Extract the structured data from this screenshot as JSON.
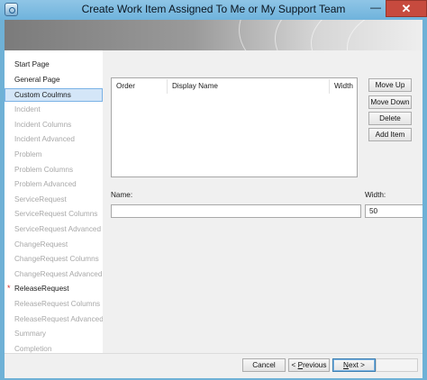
{
  "window": {
    "title": "Create Work Item Assigned To Me or My Support Team",
    "minimize_glyph": "—",
    "close_glyph": "✕"
  },
  "nav": {
    "items": [
      {
        "label": "Start Page",
        "state": "enabled"
      },
      {
        "label": "General Page",
        "state": "enabled"
      },
      {
        "label": "Custom Coulmns",
        "state": "selected"
      },
      {
        "label": "Incident",
        "state": "disabled"
      },
      {
        "label": "Incident Columns",
        "state": "disabled"
      },
      {
        "label": "Incident Advanced",
        "state": "disabled"
      },
      {
        "label": "Problem",
        "state": "disabled"
      },
      {
        "label": "Problem Columns",
        "state": "disabled"
      },
      {
        "label": "Problem Advanced",
        "state": "disabled"
      },
      {
        "label": "ServiceRequest",
        "state": "disabled"
      },
      {
        "label": "ServiceRequest Columns",
        "state": "disabled"
      },
      {
        "label": "ServiceRequest Advanced",
        "state": "disabled"
      },
      {
        "label": "ChangeRequest",
        "state": "disabled"
      },
      {
        "label": "ChangeRequest Columns",
        "state": "disabled"
      },
      {
        "label": "ChangeRequest Advanced",
        "state": "disabled"
      },
      {
        "label": "ReleaseRequest",
        "state": "enabled",
        "required_marker": "*"
      },
      {
        "label": "ReleaseRequest Columns",
        "state": "disabled"
      },
      {
        "label": "ReleaseRequest Advanced",
        "state": "disabled"
      },
      {
        "label": "Summary",
        "state": "disabled"
      },
      {
        "label": "Completion",
        "state": "disabled"
      }
    ]
  },
  "columns_list": {
    "headers": [
      "Order",
      "Display Name",
      "Width"
    ],
    "rows": []
  },
  "actions": {
    "move_up": "Move Up",
    "move_down": "Move Down",
    "delete": "Delete",
    "add_item": "Add Item"
  },
  "form": {
    "name_label": "Name:",
    "name_value": "",
    "width_label": "Width:",
    "width_value": "50"
  },
  "footer": {
    "cancel": "Cancel",
    "previous": "< Previous",
    "next": "Next >",
    "finish": ""
  }
}
